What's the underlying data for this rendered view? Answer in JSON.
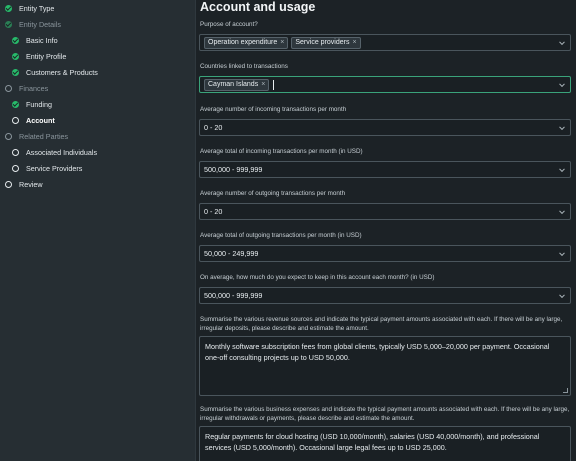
{
  "sidebar": {
    "items": [
      {
        "label": "Entity Type",
        "state": "done"
      },
      {
        "label": "Entity Details",
        "state": "muted-done"
      },
      {
        "label": "Basic Info",
        "state": "done"
      },
      {
        "label": "Entity Profile",
        "state": "done"
      },
      {
        "label": "Customers & Products",
        "state": "done"
      },
      {
        "label": "Finances",
        "state": "muted-empty"
      },
      {
        "label": "Funding",
        "state": "done"
      },
      {
        "label": "Account",
        "state": "active"
      },
      {
        "label": "Related Parties",
        "state": "muted-empty"
      },
      {
        "label": "Associated Individuals",
        "state": "empty"
      },
      {
        "label": "Service Providers",
        "state": "empty"
      },
      {
        "label": "Review",
        "state": "empty"
      }
    ]
  },
  "main": {
    "title": "Account and usage",
    "purpose": {
      "label": "Purpose of account?",
      "chips": [
        "Operation expenditure",
        "Service providers"
      ]
    },
    "countries": {
      "label": "Countries linked to transactions",
      "chips": [
        "Cayman Islands"
      ]
    },
    "incoming_count": {
      "label": "Average number of incoming transactions per month",
      "value": "0 - 20"
    },
    "incoming_total": {
      "label": "Average total of incoming transactions per month (in USD)",
      "value": "500,000 - 999,999"
    },
    "outgoing_count": {
      "label": "Average number of outgoing transactions per month",
      "value": "0 - 20"
    },
    "outgoing_total": {
      "label": "Average total of outgoing transactions per month (in USD)",
      "value": "50,000 - 249,999"
    },
    "keep_amount": {
      "label": "On average, how much do you expect to keep in this account each month? (in USD)",
      "value": "500,000 - 999,999"
    },
    "revenue": {
      "label": "Summarise the various revenue sources and indicate the typical payment amounts associated with each. If there will be any large, irregular deposits, please describe and estimate the amount.",
      "value": "Monthly software subscription fees from global clients, typically USD 5,000–20,000 per payment. Occasional one-off consulting projects up to USD 50,000."
    },
    "expenses": {
      "label": "Summarise the various business expenses and indicate the typical payment amounts associated with each. If there will be any large, irregular withdrawals or payments, please describe and estimate the amount.",
      "value": "Regular payments for cloud hosting (USD 10,000/month), salaries (USD 40,000/month), and professional services (USD 5,000/month). Occasional large legal fees up to USD 25,000."
    }
  },
  "colors": {
    "accent": "#27b96a",
    "focus": "#3aa37a",
    "background": "#1c2226",
    "sidebar": "#262e33"
  }
}
